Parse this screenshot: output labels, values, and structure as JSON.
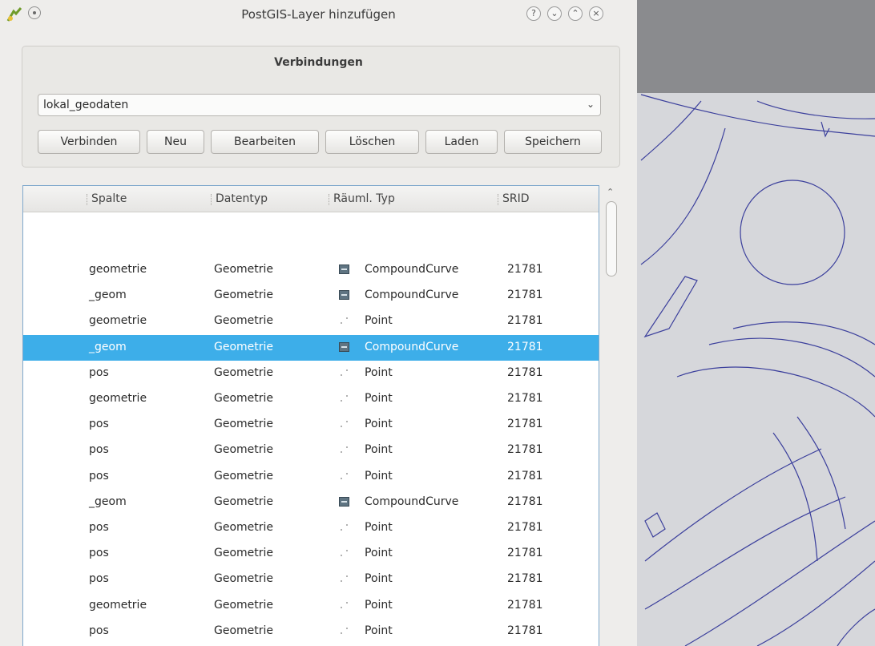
{
  "window": {
    "title": "PostGIS-Layer hinzufügen",
    "buttons": {
      "help": "?",
      "minimize": "⌄",
      "maximize": "⌃",
      "close": "×"
    }
  },
  "connections": {
    "group_title": "Verbindungen",
    "selected": "lokal_geodaten",
    "buttons": {
      "connect": "Verbinden",
      "new": "Neu",
      "edit": "Bearbeiten",
      "delete": "Löschen",
      "load": "Laden",
      "save": "Speichern"
    }
  },
  "table": {
    "headers": {
      "column": "Spalte",
      "datatype": "Datentyp",
      "spatial_type": "Räuml. Typ",
      "srid": "SRID"
    },
    "selected_row": 3,
    "rows": [
      {
        "column": "geometrie",
        "datatype": "Geometrie",
        "icon": "compound-curve-icon",
        "spatial_type": "CompoundCurve",
        "srid": "21781"
      },
      {
        "column": "_geom",
        "datatype": "Geometrie",
        "icon": "compound-curve-icon",
        "spatial_type": "CompoundCurve",
        "srid": "21781"
      },
      {
        "column": "geometrie",
        "datatype": "Geometrie",
        "icon": "point-icon",
        "spatial_type": "Point",
        "srid": "21781"
      },
      {
        "column": "_geom",
        "datatype": "Geometrie",
        "icon": "compound-curve-icon",
        "spatial_type": "CompoundCurve",
        "srid": "21781"
      },
      {
        "column": "pos",
        "datatype": "Geometrie",
        "icon": "point-icon",
        "spatial_type": "Point",
        "srid": "21781"
      },
      {
        "column": "geometrie",
        "datatype": "Geometrie",
        "icon": "point-icon",
        "spatial_type": "Point",
        "srid": "21781"
      },
      {
        "column": "pos",
        "datatype": "Geometrie",
        "icon": "point-icon",
        "spatial_type": "Point",
        "srid": "21781"
      },
      {
        "column": "pos",
        "datatype": "Geometrie",
        "icon": "point-icon",
        "spatial_type": "Point",
        "srid": "21781"
      },
      {
        "column": "pos",
        "datatype": "Geometrie",
        "icon": "point-icon",
        "spatial_type": "Point",
        "srid": "21781"
      },
      {
        "column": "_geom",
        "datatype": "Geometrie",
        "icon": "compound-curve-icon",
        "spatial_type": "CompoundCurve",
        "srid": "21781"
      },
      {
        "column": "pos",
        "datatype": "Geometrie",
        "icon": "point-icon",
        "spatial_type": "Point",
        "srid": "21781"
      },
      {
        "column": "pos",
        "datatype": "Geometrie",
        "icon": "point-icon",
        "spatial_type": "Point",
        "srid": "21781"
      },
      {
        "column": "pos",
        "datatype": "Geometrie",
        "icon": "point-icon",
        "spatial_type": "Point",
        "srid": "21781"
      },
      {
        "column": "geometrie",
        "datatype": "Geometrie",
        "icon": "point-icon",
        "spatial_type": "Point",
        "srid": "21781"
      },
      {
        "column": "pos",
        "datatype": "Geometrie",
        "icon": "point-icon",
        "spatial_type": "Point",
        "srid": "21781"
      }
    ]
  },
  "colors": {
    "selection": "#3daee9",
    "map_lines": "#3b3f9c",
    "map_background": "#d6d7db"
  }
}
